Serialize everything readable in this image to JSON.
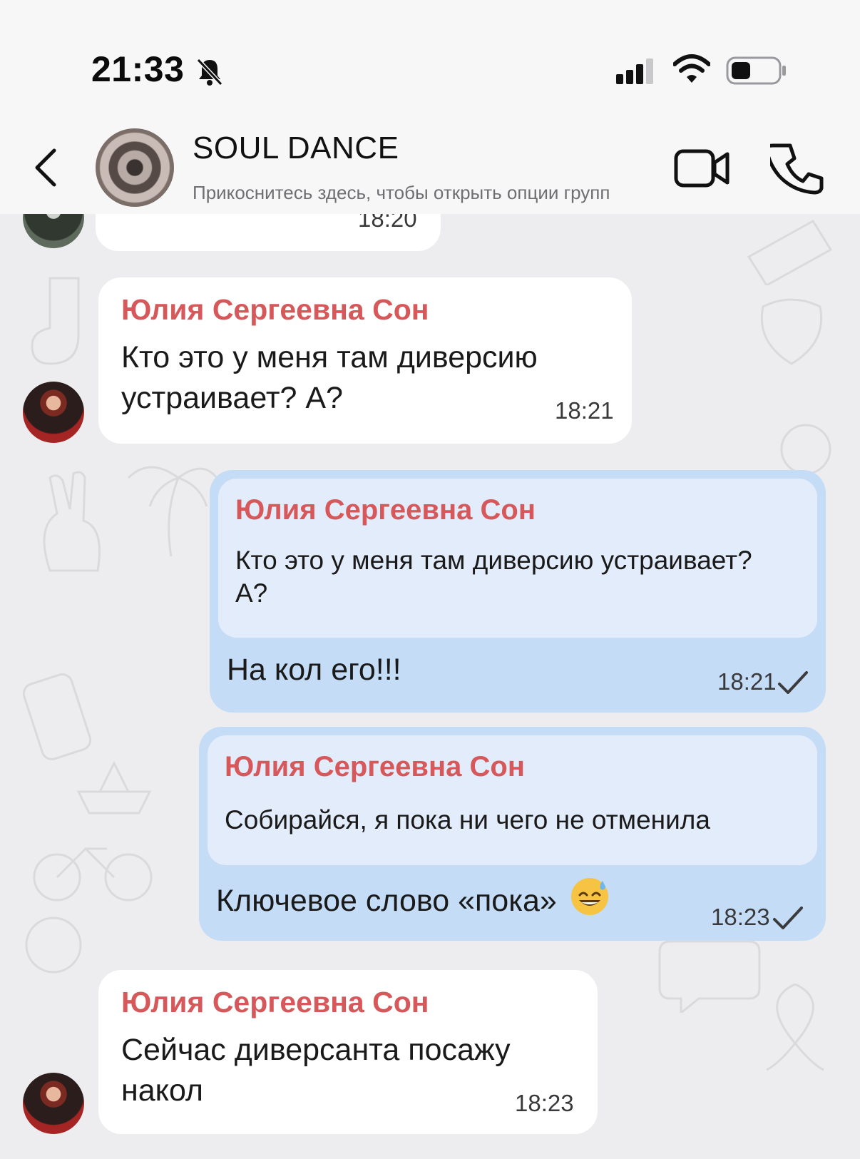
{
  "status_bar": {
    "time": "21:33"
  },
  "header": {
    "title": "SOUL DANCE",
    "subtitle": "Прикоснитесь здесь, чтобы открыть опции групп"
  },
  "messages": [
    {
      "sender": "Юлия Сергеевна Сон",
      "text_line1": "Кто это у меня там диверсию",
      "text_line2": "устраивает? А?",
      "time": "18:21"
    },
    {
      "quote_sender": "Юлия Сергеевна Сон",
      "quote_line1": "Кто это у меня там диверсию устраивает?",
      "quote_line2": "А?",
      "text": "На кол его!!!",
      "time": "18:21"
    },
    {
      "quote_sender": "Юлия Сергеевна Сон",
      "quote_text": "Собирайся, я пока ни чего не отменила",
      "text": "Ключевое слово «пока»",
      "emoji": "sweat-smile-emoji",
      "time": "18:23"
    },
    {
      "sender": "Юлия Сергеевна Сон",
      "text_line1": "Сейчас диверсанта посажу",
      "text_line2": "накол",
      "time": "18:23"
    }
  ],
  "partial_message": {
    "time": "18:20"
  },
  "colors": {
    "sender_name": "#d6585a",
    "outgoing_bubble": "#c4dcf6",
    "quote_bg": "#e3ecfa",
    "incoming_bubble": "#ffffff"
  }
}
